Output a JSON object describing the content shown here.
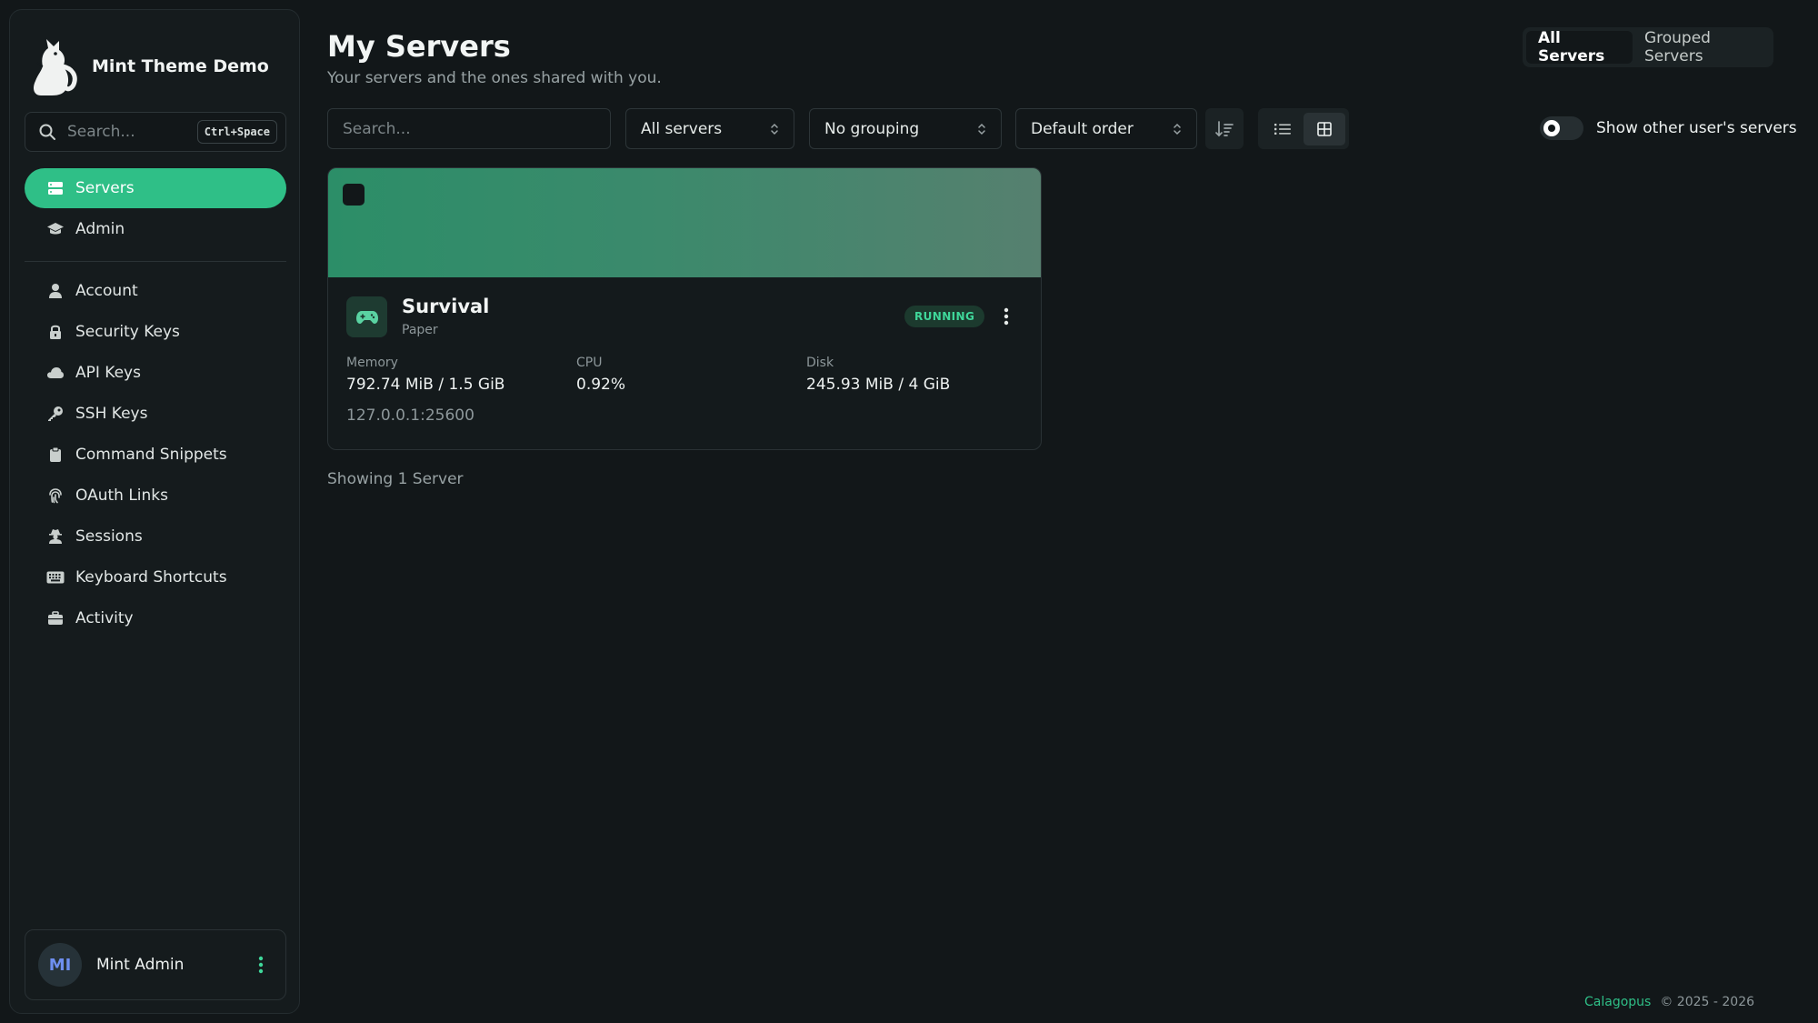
{
  "app": {
    "name": "Mint Theme Demo"
  },
  "sidebar": {
    "search": {
      "placeholder": "Search...",
      "shortcut": "Ctrl+Space"
    },
    "primary_items": [
      {
        "label": "Servers",
        "icon": "server-icon",
        "active": true
      },
      {
        "label": "Admin",
        "icon": "graduation-cap-icon",
        "active": false
      }
    ],
    "account_items": [
      {
        "label": "Account",
        "icon": "user-icon"
      },
      {
        "label": "Security Keys",
        "icon": "lock-icon"
      },
      {
        "label": "API Keys",
        "icon": "cloud-icon"
      },
      {
        "label": "SSH Keys",
        "icon": "key-icon"
      },
      {
        "label": "Command Snippets",
        "icon": "clipboard-icon"
      },
      {
        "label": "OAuth Links",
        "icon": "fingerprint-icon"
      },
      {
        "label": "Sessions",
        "icon": "user-secret-icon"
      },
      {
        "label": "Keyboard Shortcuts",
        "icon": "keyboard-icon"
      },
      {
        "label": "Activity",
        "icon": "briefcase-icon"
      }
    ],
    "user": {
      "initials": "MI",
      "name": "Mint Admin"
    }
  },
  "header": {
    "title": "My Servers",
    "subtitle": "Your servers and the ones shared with you.",
    "tabs": [
      {
        "label": "All Servers",
        "active": true
      },
      {
        "label": "Grouped Servers",
        "active": false
      }
    ]
  },
  "toolbar": {
    "search_placeholder": "Search...",
    "filter_value": "All servers",
    "grouping_value": "No grouping",
    "order_value": "Default order",
    "view_mode": "grid",
    "toggle_label": "Show other user's servers",
    "toggle_on": false
  },
  "server": {
    "name": "Survival",
    "type": "Paper",
    "status": "RUNNING",
    "memory_label": "Memory",
    "memory_value": "792.74 MiB / 1.5 GiB",
    "cpu_label": "CPU",
    "cpu_value": "0.92%",
    "disk_label": "Disk",
    "disk_value": "245.93 MiB / 4 GiB",
    "address": "127.0.0.1:25600"
  },
  "showing_text": "Showing 1 Server",
  "footer": {
    "link": "Calagopus",
    "copyright": "© 2025 - 2026"
  },
  "colors": {
    "accent": "#2fbf87",
    "background": "#121719",
    "sidebar": "#151b1d",
    "status_running": "#3fd79a"
  }
}
